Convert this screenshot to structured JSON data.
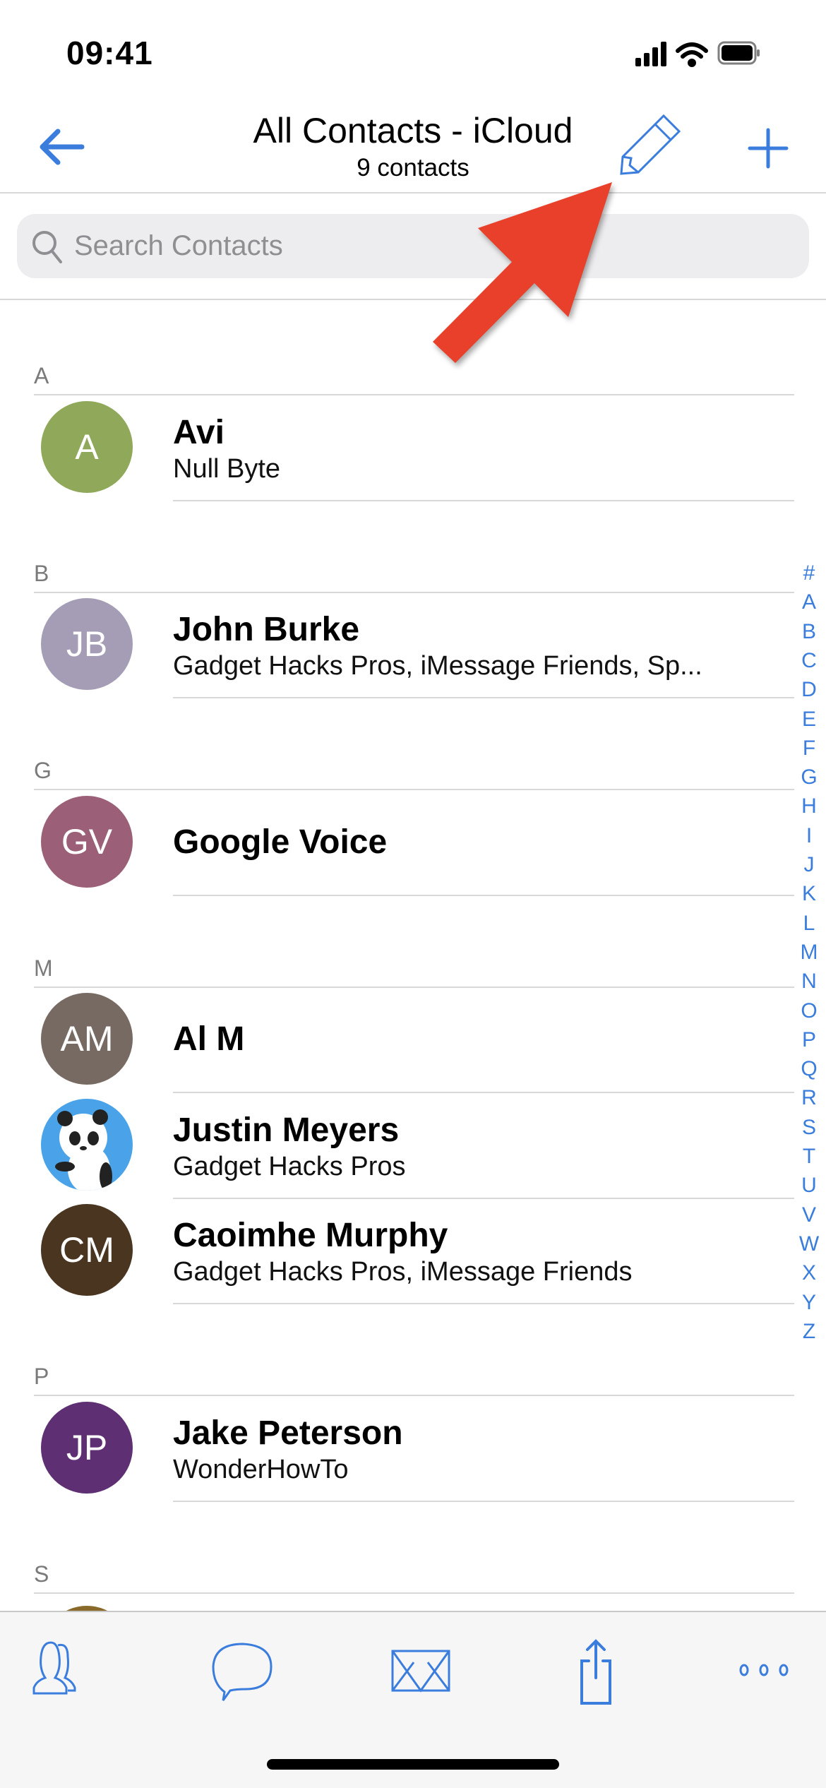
{
  "status": {
    "time": "09:41"
  },
  "nav": {
    "title": "All Contacts - iCloud",
    "subtitle": "9 contacts"
  },
  "search": {
    "placeholder": "Search Contacts"
  },
  "colors": {
    "accent": "#3b7ddd",
    "annotation_arrow": "#e8402a"
  },
  "sections": [
    {
      "letter": "A",
      "contacts": [
        {
          "initials": "A",
          "name": "Avi",
          "detail": "Null Byte",
          "color": "#8fa85a"
        }
      ]
    },
    {
      "letter": "B",
      "contacts": [
        {
          "initials": "JB",
          "name": "John Burke",
          "detail": "Gadget Hacks Pros, iMessage Friends, Sp...",
          "color": "#a59db5"
        }
      ]
    },
    {
      "letter": "G",
      "contacts": [
        {
          "initials": "GV",
          "name": "Google Voice",
          "detail": "",
          "color": "#9b5f78"
        }
      ]
    },
    {
      "letter": "M",
      "contacts": [
        {
          "initials": "AM",
          "name": "Al M",
          "detail": "",
          "color": "#776a62"
        },
        {
          "initials": "",
          "name": "Justin Meyers",
          "detail": "Gadget Hacks Pros",
          "color": "#4aa3e8"
        },
        {
          "initials": "CM",
          "name": "Caoimhe Murphy",
          "detail": "Gadget Hacks Pros, iMessage Friends",
          "color": "#4a3520"
        }
      ]
    },
    {
      "letter": "P",
      "contacts": [
        {
          "initials": "JP",
          "name": "Jake Peterson",
          "detail": "WonderHowTo",
          "color": "#5e2f72"
        }
      ]
    },
    {
      "letter": "S",
      "contacts": []
    }
  ],
  "index": [
    "#",
    "A",
    "B",
    "C",
    "D",
    "E",
    "F",
    "G",
    "H",
    "I",
    "J",
    "K",
    "L",
    "M",
    "N",
    "O",
    "P",
    "Q",
    "R",
    "S",
    "T",
    "U",
    "V",
    "W",
    "X",
    "Y",
    "Z"
  ],
  "tabs": [
    "contacts-icon",
    "message-icon",
    "mail-icon",
    "share-icon",
    "more-icon"
  ]
}
